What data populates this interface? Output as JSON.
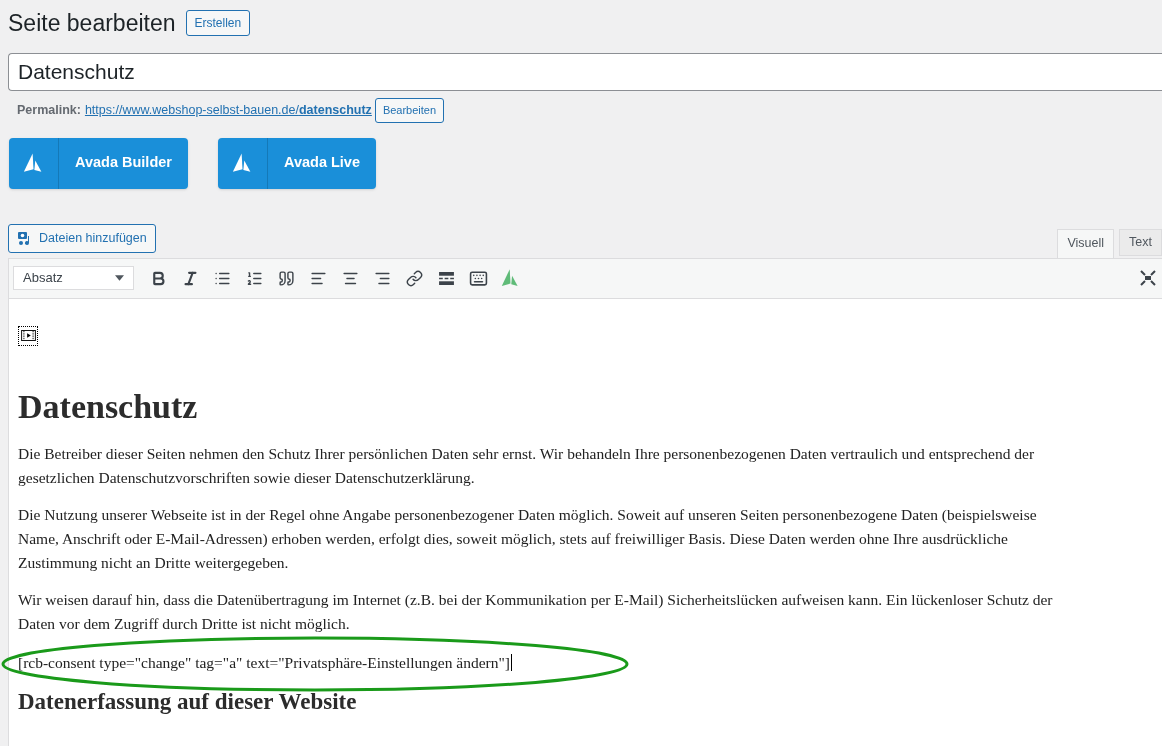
{
  "header": {
    "title": "Seite bearbeiten",
    "button": "Erstellen"
  },
  "title_field": {
    "value": "Datenschutz"
  },
  "permalink": {
    "label": "Permalink:",
    "url_base": "https://www.webshop-selbst-bauen.de/",
    "url_slug": "datenschutz",
    "button": "Bearbeiten"
  },
  "builder_buttons": [
    "Avada Builder",
    "Avada Live"
  ],
  "media_button": "Dateien hinzufügen",
  "editor_tabs": [
    {
      "label": "Visuell",
      "selected": true
    },
    {
      "label": "Text",
      "selected": false
    }
  ],
  "toolbar": {
    "format": "Absatz"
  },
  "content": [
    {
      "kind": "media"
    },
    {
      "kind": "h1",
      "text": "Datenschutz"
    },
    {
      "kind": "p",
      "text": "Die Betreiber dieser Seiten nehmen den Schutz Ihrer persönlichen Daten sehr ernst. Wir behandeln Ihre personenbezogenen Daten vertraulich und entsprechend der gesetzlichen Datenschutzvorschriften sowie dieser Datenschutzerklärung."
    },
    {
      "kind": "p",
      "text": "Die Nutzung unserer Webseite ist in der Regel ohne Angabe personenbezogener Daten möglich. Soweit auf unseren Seiten personenbezogene Daten (beispielsweise Name, Anschrift oder E-Mail-Adressen) erhoben werden, erfolgt dies, soweit möglich, stets auf freiwilliger Basis. Diese Daten werden ohne Ihre ausdrückliche Zustimmung nicht an Dritte weitergegeben."
    },
    {
      "kind": "p",
      "text": "Wir weisen darauf hin, dass die Datenübertragung im Internet (z.B. bei der Kommunikation per E-Mail) Sicherheitslücken aufweisen kann. Ein lückenloser Schutz der Daten vor dem Zugriff durch Dritte ist nicht möglich."
    },
    {
      "kind": "shortcode",
      "text": "[rcb-consent type=\"change\" tag=\"a\" text=\"Privatsphäre-Einstellungen ändern\"]",
      "highlighted": true
    },
    {
      "kind": "h2",
      "text": "Datenerfassung auf dieser Website"
    }
  ]
}
